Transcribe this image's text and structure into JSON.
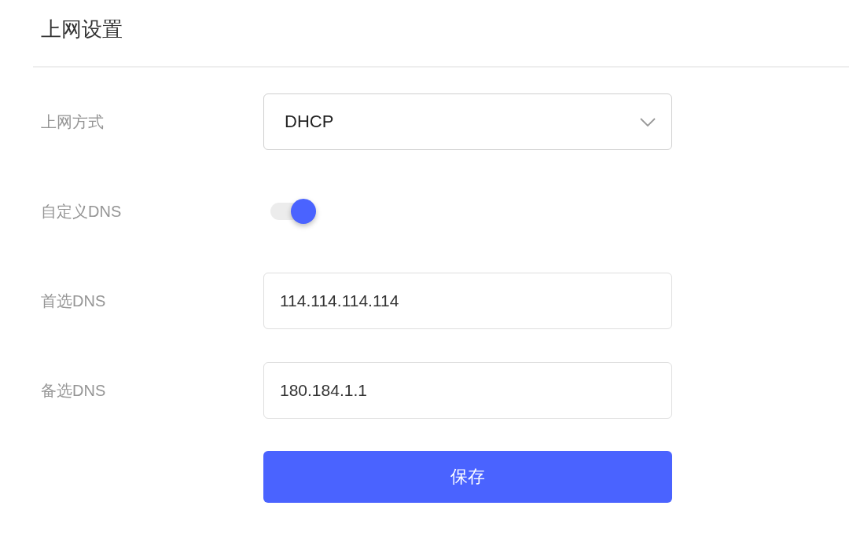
{
  "page": {
    "title": "上网设置"
  },
  "fields": [
    {
      "kind": "select",
      "label": "上网方式",
      "value": "DHCP"
    },
    {
      "kind": "switch",
      "label": "自定义DNS",
      "on": true
    },
    {
      "kind": "text",
      "label": "首选DNS",
      "value": "114.114.114.114"
    },
    {
      "kind": "text",
      "label": "备选DNS",
      "value": "180.184.1.1"
    }
  ],
  "save_button": {
    "label": "保存"
  }
}
